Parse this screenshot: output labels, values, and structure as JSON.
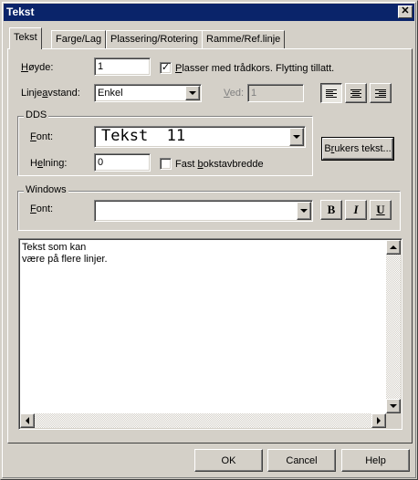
{
  "window": {
    "title": "Tekst",
    "close_symbol": "✕"
  },
  "tabs": [
    {
      "label": "Tekst",
      "active": true
    },
    {
      "label": "Farge/Lag",
      "active": false
    },
    {
      "label": "Plassering/Rotering",
      "active": false
    },
    {
      "label": "Ramme/Ref.linje",
      "active": false
    }
  ],
  "height_field": {
    "label_pre": "",
    "label_u": "H",
    "label_post": "øyde:",
    "value": "1"
  },
  "crosshair_checkbox": {
    "checked": true,
    "label_pre": "",
    "label_u": "P",
    "label_post": "lasser med trådkors. Flytting tillatt."
  },
  "line_spacing": {
    "label_pre": "Linje",
    "label_u": "a",
    "label_post": "vstand:",
    "value": "Enkel"
  },
  "ved_field": {
    "label_pre": "",
    "label_u": "V",
    "label_post": "ed:",
    "value": "1"
  },
  "alignment_buttons": [
    "align-left",
    "align-center",
    "align-right"
  ],
  "dds_group": {
    "legend": "DDS",
    "font_label_pre": "",
    "font_label_u": "F",
    "font_label_post": "ont:",
    "font_value": "Tekst  11",
    "slant_label_pre": "H",
    "slant_label_u": "e",
    "slant_label_post": "lning:",
    "slant_value": "0",
    "fixed_width": {
      "checked": false,
      "label_pre": "Fast ",
      "label_u": "b",
      "label_post": "okstavbredde"
    },
    "user_text_button_pre": "B",
    "user_text_button_u": "r",
    "user_text_button_post": "ukers tekst..."
  },
  "windows_group": {
    "legend": "Windows",
    "font_label_pre": "",
    "font_label_u": "F",
    "font_label_post": "ont:",
    "font_value": "",
    "bold_label": "B",
    "italic_label": "I",
    "underline_label": "U"
  },
  "text_content": "Tekst som kan\nvære på flere linjer.",
  "footer": {
    "ok": "OK",
    "cancel": "Cancel",
    "help": "Help"
  }
}
